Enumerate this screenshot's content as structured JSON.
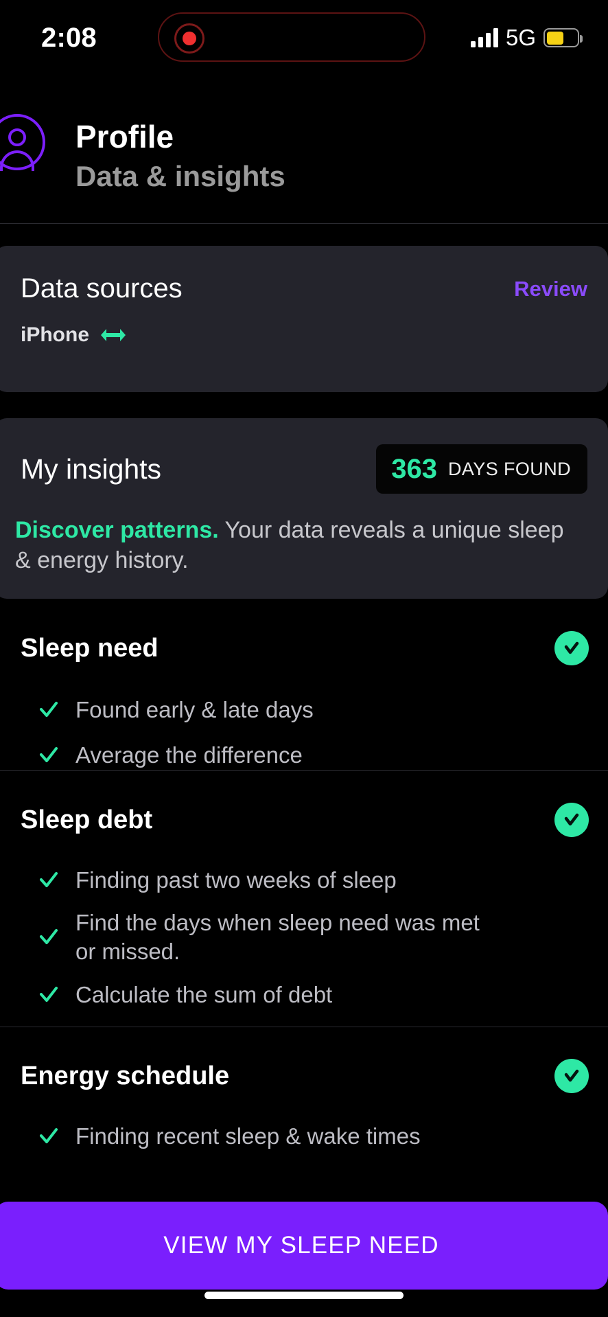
{
  "status_bar": {
    "time": "2:08",
    "network": "5G",
    "signal_icon": "signal-bars-icon",
    "battery_icon": "battery-low-power-icon",
    "battery_color": "#f5d115",
    "recording_icon": "recording-indicator-icon"
  },
  "header": {
    "avatar_icon": "profile-avatar-icon",
    "title": "Profile",
    "subtitle": "Data & insights"
  },
  "data_sources": {
    "title": "Data sources",
    "review_label": "Review",
    "device_name": "iPhone",
    "sync_icon": "sync-arrows-icon",
    "accent_color": "#8a4bfb"
  },
  "insights": {
    "title": "My insights",
    "days_count": "363",
    "days_label": "DAYS FOUND",
    "highlight": "Discover patterns.",
    "description": " Your data reveals a unique sleep & energy history.",
    "accent_color": "#2ee8a5"
  },
  "sections": [
    {
      "title": "Sleep need",
      "status_icon": "check-circle-icon",
      "steps": [
        "Found early & late days",
        "Average the difference"
      ]
    },
    {
      "title": "Sleep debt",
      "status_icon": "check-circle-icon",
      "steps": [
        "Finding past two weeks of sleep",
        "Find the days when sleep need was met or missed.",
        "Calculate the sum of debt"
      ]
    },
    {
      "title": "Energy schedule",
      "status_icon": "check-circle-icon",
      "steps": [
        "Finding recent sleep & wake times"
      ]
    }
  ],
  "cta": {
    "label": "VIEW MY SLEEP NEED",
    "color": "#7a1ffd"
  }
}
